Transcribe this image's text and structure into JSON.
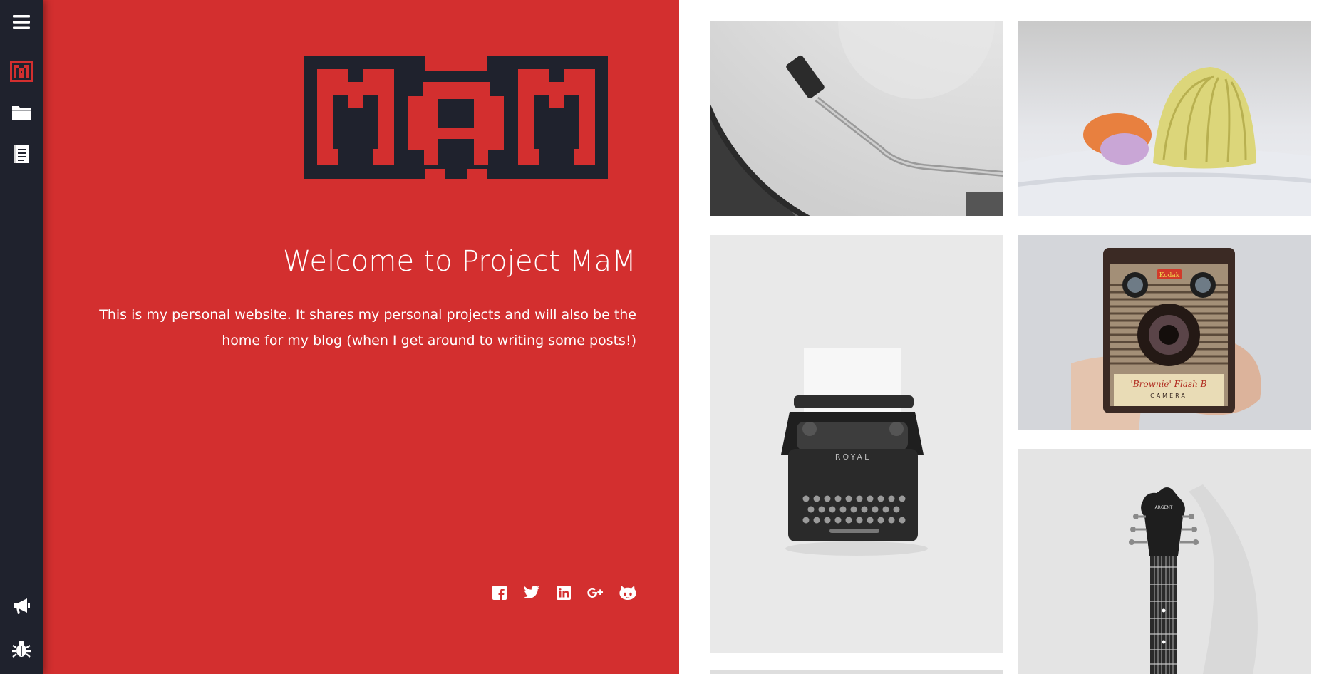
{
  "sidebar": {
    "items": [
      {
        "name": "menu-icon",
        "color": "#ffffff"
      },
      {
        "name": "mam-logo-icon",
        "color": "#d32f2f"
      },
      {
        "name": "folder-icon",
        "color": "#ffffff"
      },
      {
        "name": "document-icon",
        "color": "#ffffff"
      }
    ],
    "bottom_items": [
      {
        "name": "megaphone-icon",
        "color": "#ffffff"
      },
      {
        "name": "bug-icon",
        "color": "#ffffff"
      }
    ]
  },
  "hero": {
    "logo_text": "MaM",
    "title": "Welcome to Project MaM",
    "description": "This is my personal website. It shares my personal projects and will also be the home for my blog (when I get around to writing some posts!)",
    "background_color": "#d32f2f",
    "logo_color": "#1f222d",
    "social": [
      {
        "name": "facebook-icon"
      },
      {
        "name": "twitter-icon"
      },
      {
        "name": "linkedin-icon"
      },
      {
        "name": "google-plus-icon"
      },
      {
        "name": "github-icon"
      }
    ]
  },
  "gallery": {
    "tiles": [
      {
        "name": "photo-turntable",
        "subject": "turntable"
      },
      {
        "name": "photo-seashells",
        "subject": "seashells"
      },
      {
        "name": "photo-typewriter",
        "subject": "typewriter"
      },
      {
        "name": "photo-camera",
        "subject": "kodak camera"
      },
      {
        "name": "photo-guitar",
        "subject": "guitar neck"
      }
    ],
    "camera_brand": "Kodak",
    "camera_model": "'Brownie' Flash B",
    "camera_word": "CAMERA",
    "typewriter_brand": "ROYAL",
    "guitar_brand": "ARGENT"
  }
}
